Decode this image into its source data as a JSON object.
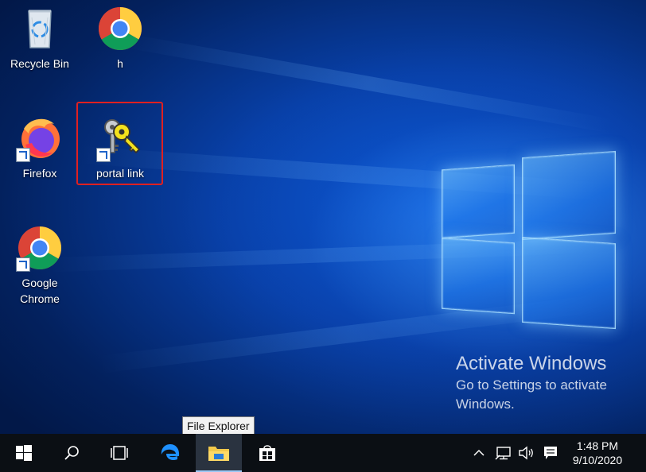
{
  "desktop_icons": [
    {
      "id": "recycle-bin",
      "label": "Recycle Bin"
    },
    {
      "id": "chrome-h",
      "label": "h"
    },
    {
      "id": "firefox",
      "label": "Firefox"
    },
    {
      "id": "portal-link",
      "label": "portal link"
    },
    {
      "id": "google-chrome",
      "label": "Google Chrome"
    }
  ],
  "activation": {
    "title": "Activate Windows",
    "message": "Go to Settings to activate Windows."
  },
  "tooltip": "File Explorer",
  "taskbar": {
    "buttons": [
      "start",
      "search",
      "task-view",
      "edge",
      "file-explorer",
      "store"
    ],
    "active": "file-explorer"
  },
  "clock": {
    "time": "1:48 PM",
    "date": "9/10/2020"
  },
  "colors": {
    "highlight": "#e02020",
    "taskbar": "#0b0f14",
    "accent": "#1f63c9"
  }
}
